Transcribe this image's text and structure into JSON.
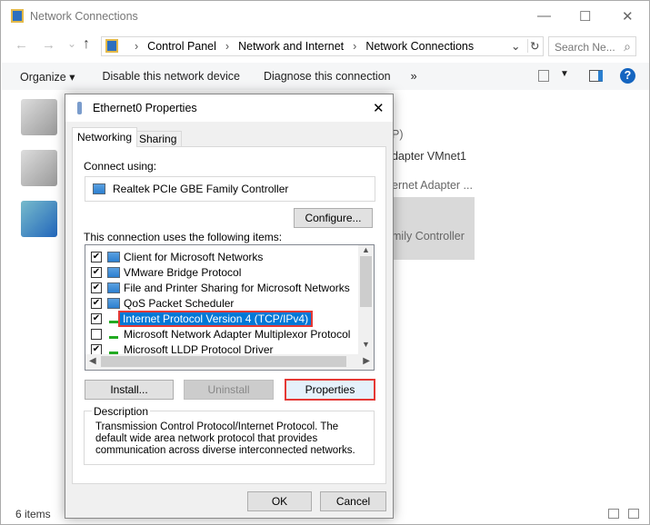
{
  "window": {
    "title": "Network Connections",
    "minimize": "—",
    "maximize": "☐",
    "close": "✕"
  },
  "nav": {
    "back": "←",
    "forward": "→",
    "recent": "⌄",
    "up": "↑",
    "breadcrumb": [
      "Control Panel",
      "Network and Internet",
      "Network Connections"
    ],
    "refresh": "↻",
    "dropdown": "⌄",
    "search_placeholder": "Search Ne...",
    "search_icon": "⌕"
  },
  "toolbar": {
    "organize": "Organize ▾",
    "disable": "Disable this network device",
    "diagnose": "Diagnose this connection",
    "more": "»",
    "help": "?"
  },
  "background_items": [
    "P)",
    "dapter VMnet1",
    "ernet Adapter ...",
    "mily Controller"
  ],
  "status": "6 items",
  "dialog": {
    "title": "Ethernet0 Properties",
    "close": "✕",
    "tabs": [
      "Networking",
      "Sharing"
    ],
    "connect_using_label": "Connect using:",
    "adapter": "Realtek PCIe GBE Family Controller",
    "configure": "Configure...",
    "items_label": "This connection uses the following items:",
    "items": [
      {
        "label": "Client for Microsoft Networks",
        "checked": true
      },
      {
        "label": "VMware Bridge Protocol",
        "checked": true
      },
      {
        "label": "File and Printer Sharing for Microsoft Networks",
        "checked": true
      },
      {
        "label": "QoS Packet Scheduler",
        "checked": true
      },
      {
        "label": "Internet Protocol Version 4 (TCP/IPv4)",
        "checked": true,
        "selected": true
      },
      {
        "label": "Microsoft Network Adapter Multiplexor Protocol",
        "checked": false
      },
      {
        "label": "Microsoft LLDP Protocol Driver",
        "checked": true
      }
    ],
    "install": "Install...",
    "uninstall": "Uninstall",
    "properties": "Properties",
    "description_label": "Description",
    "description": "Transmission Control Protocol/Internet Protocol. The default wide area network protocol that provides communication across diverse interconnected networks.",
    "ok": "OK",
    "cancel": "Cancel"
  },
  "highlight_color": "#e53935",
  "selection_color": "#0078d7"
}
